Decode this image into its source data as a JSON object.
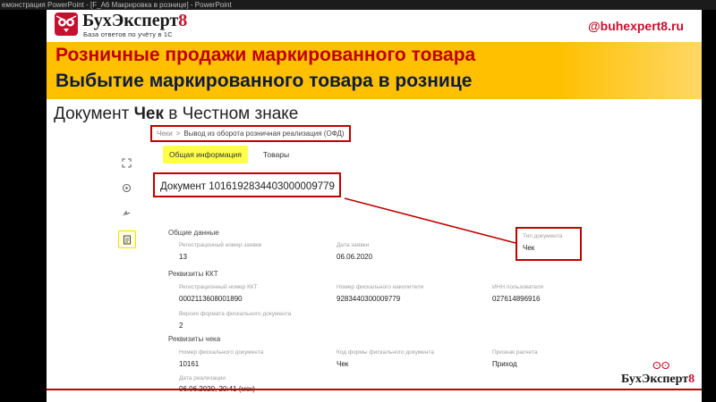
{
  "window": {
    "title": "емонстрация PowerPoint - [F_A6 Макрировка в рознице] - PowerPoint"
  },
  "logo": {
    "name_main": "БухЭксперт",
    "name_digit": "8",
    "tagline": "База ответов по учёту в 1С"
  },
  "site": "@buhexpert8.ru",
  "banner": {
    "line1": "Розничные продажи маркированного товара",
    "line2": "Выбытие маркированного товара в рознице"
  },
  "subtitle": {
    "prefix": "Документ ",
    "bold": "Чек",
    "suffix": " в Честном знаке"
  },
  "app": {
    "breadcrumb": {
      "item1": "Чеки",
      "separator": ">",
      "item2": "Вывод из оборота розничная реализация (ОФД)"
    },
    "tabs": [
      {
        "label": "Общая информация"
      },
      {
        "label": "Товары"
      }
    ],
    "document_title": "Документ 1016192834403000009779",
    "sections": {
      "general": {
        "heading": "Общие данные",
        "reg_number_label": "Регистрацонный номер заявки",
        "reg_number_value": "13",
        "date_label": "Дата заявки",
        "date_value": "06.06.2020",
        "doc_type_label": "Тип документа",
        "doc_type_value": "Чек"
      },
      "kkt": {
        "heading": "Реквизиты ККТ",
        "reg_kkt_label": "Регистрационный номер ККТ",
        "reg_kkt_value": "0002113608001890",
        "fn_label": "Номер фискального накопителя",
        "fn_value": "9283440300009779",
        "inn_label": "ИНН пользователя",
        "inn_value": "027614896916",
        "format_label": "Версия формата фискального документа",
        "format_value": "2"
      },
      "receipt": {
        "heading": "Реквизиты чека",
        "fd_label": "Номер фискального документа",
        "fd_value": "10161",
        "form_label": "Код формы фискального документа",
        "form_value": "Чек",
        "sign_label": "Признак расчета",
        "sign_value": "Приход",
        "sale_date_label": "Дата реализации",
        "sale_date_value": "06.06.2020, 20:41 (мск)"
      }
    }
  },
  "watermark": {
    "name_main": "БухЭксперт",
    "name_digit": "8"
  },
  "colors": {
    "accent_red": "#c00000",
    "banner_yellow": "#ffc000",
    "tab_highlight": "#ffff4a"
  },
  "icons": [
    "logo-owl-icon",
    "fullscreen-icon",
    "gear-icon",
    "sync-icon",
    "document-icon"
  ]
}
